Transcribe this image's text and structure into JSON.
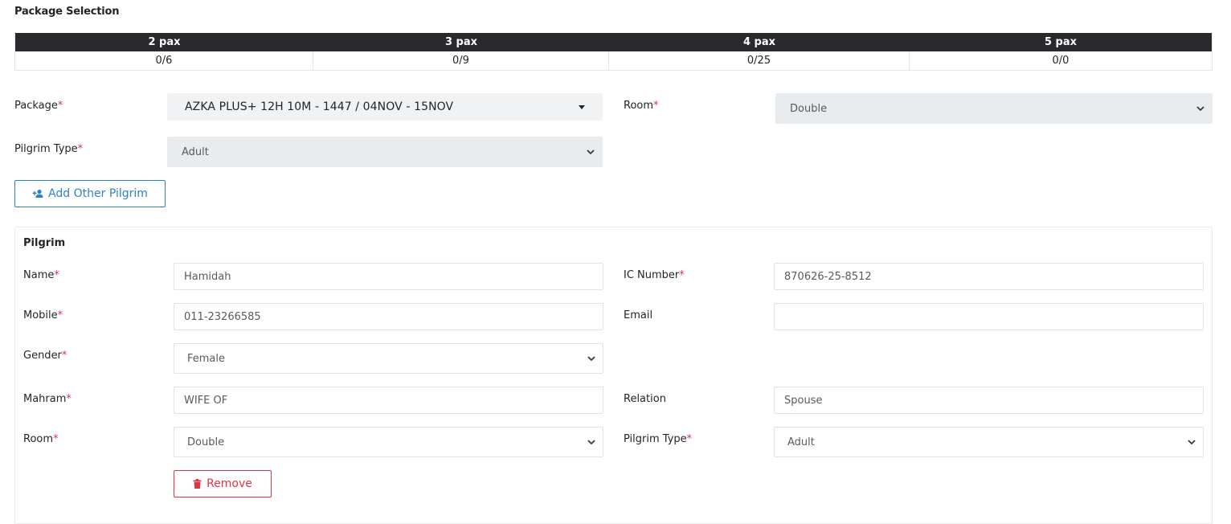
{
  "section_title": "Package Selection",
  "pax_table": {
    "headers": [
      "2 pax",
      "3 pax",
      "4 pax",
      "5 pax"
    ],
    "values": [
      "0/6",
      "0/9",
      "0/25",
      "0/0"
    ]
  },
  "package": {
    "label": "Package",
    "required_mark": "*",
    "selected": "AZKA PLUS+ 12H 10M - 1447 / 04NOV - 15NOV"
  },
  "room": {
    "label": "Room",
    "required_mark": "*",
    "selected": "Double"
  },
  "pilgrim_type": {
    "label": "Pilgrim Type",
    "required_mark": "*",
    "selected": "Adult"
  },
  "add_pilgrim_button": {
    "label": "Add Other Pilgrim",
    "icon": "user-plus-icon"
  },
  "pilgrim_card": {
    "title": "Pilgrim",
    "fields": {
      "name": {
        "label": "Name",
        "required_mark": "*",
        "value": "Hamidah"
      },
      "ic_number": {
        "label": "IC Number",
        "required_mark": "*",
        "value": "870626-25-8512"
      },
      "mobile": {
        "label": "Mobile",
        "required_mark": "*",
        "value": "011-23266585"
      },
      "email": {
        "label": "Email",
        "value": ""
      },
      "gender": {
        "label": "Gender",
        "required_mark": "*",
        "selected": "Female"
      },
      "mahram": {
        "label": "Mahram",
        "required_mark": "*",
        "value": "WIFE OF"
      },
      "relation": {
        "label": "Relation",
        "value": "Spouse"
      },
      "room": {
        "label": "Room",
        "required_mark": "*",
        "selected": "Double"
      },
      "pilgrim_type": {
        "label": "Pilgrim Type",
        "required_mark": "*",
        "selected": "Adult"
      }
    },
    "remove_button": {
      "label": "Remove",
      "icon": "trash-icon"
    }
  },
  "colors": {
    "primary": "#2f7fce",
    "danger": "#dc3545",
    "table_header": "#2a2a2e",
    "disabled_select": "#e9ecef"
  }
}
